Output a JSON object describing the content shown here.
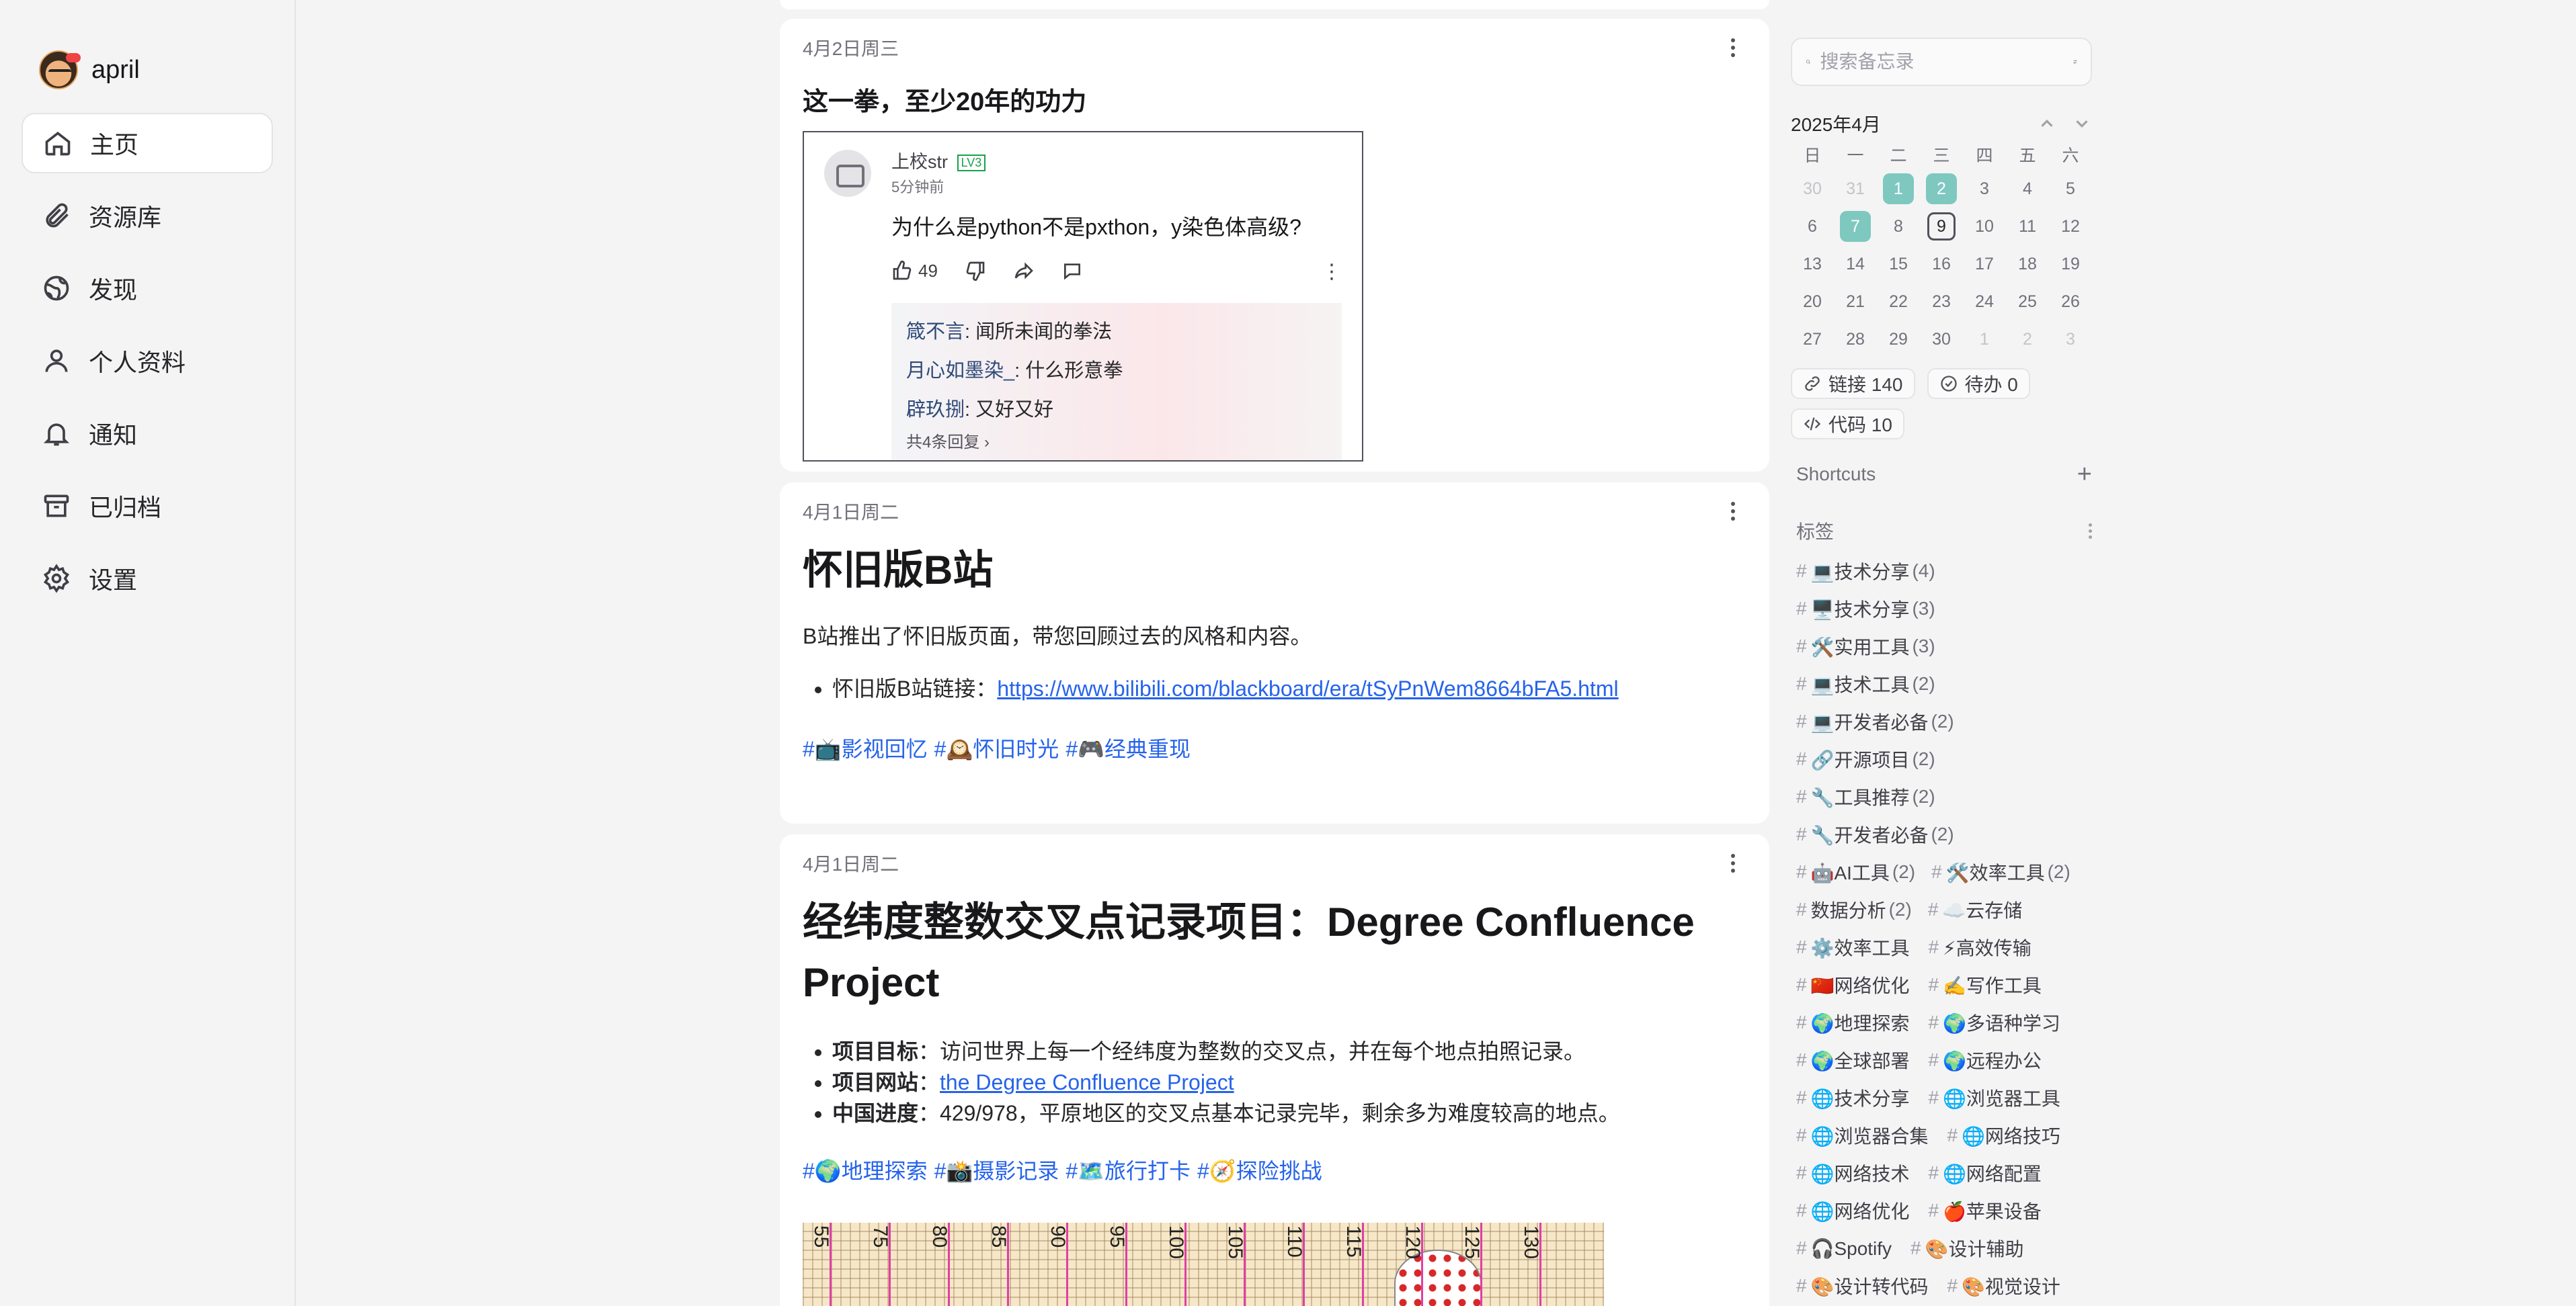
{
  "user": {
    "name": "april"
  },
  "nav": [
    {
      "id": "home",
      "label": "主页",
      "icon": "home-icon",
      "active": true
    },
    {
      "id": "resources",
      "label": "资源库",
      "icon": "paperclip-icon"
    },
    {
      "id": "explore",
      "label": "发现",
      "icon": "globe-icon"
    },
    {
      "id": "profile",
      "label": "个人资料",
      "icon": "user-icon"
    },
    {
      "id": "notifications",
      "label": "通知",
      "icon": "bell-icon"
    },
    {
      "id": "archived",
      "label": "已归档",
      "icon": "archive-icon"
    },
    {
      "id": "settings",
      "label": "设置",
      "icon": "gear-icon"
    }
  ],
  "memos": [
    {
      "date": "4月2日周三",
      "title": "这一拳，至少20年的功力",
      "embed": {
        "user": "上校str",
        "level": "LV3",
        "ago": "5分钟前",
        "question": "为什么是python不是pxthon，y染色体高级?",
        "likes": "49",
        "replies": [
          {
            "who": "箴不言",
            "text": ": 闻所未闻的拳法"
          },
          {
            "who": "月心如墨染_",
            "text": ": 什么形意拳"
          },
          {
            "who": "辟玖捌",
            "text": ": 又好又好"
          }
        ],
        "more_replies": "共4条回复 ›"
      }
    },
    {
      "date": "4月1日周二",
      "title": "怀旧版B站",
      "paragraph": "B站推出了怀旧版页面，带您回顾过去的风格和内容。",
      "bullet_label": "怀旧版B站链接：",
      "bullet_link": "https://www.bilibili.com/blackboard/era/tSyPnWem8664bFA5.html",
      "tags": [
        "#📺影视回忆",
        "#🕰️怀旧时光",
        "#🎮经典重现"
      ]
    },
    {
      "date": "4月1日周二",
      "title_line1": "经纬度整数交叉点记录项目：Degree Confluence",
      "title_line2": "Project",
      "bullets": [
        {
          "label": "项目目标",
          "text": "：访问世界上每一个经纬度为整数的交叉点，并在每个地点拍照记录。"
        },
        {
          "label": "项目网站",
          "text": "：",
          "link": "the Degree Confluence Project"
        },
        {
          "label": "中国进度",
          "text": "：429/978，平原地区的交叉点基本记录完毕，剩余多为难度较高的地点。"
        }
      ],
      "tags": [
        "#🌍地理探索",
        "#📸摄影记录",
        "#🗺️旅行打卡",
        "#🧭探险挑战"
      ],
      "map_labels": [
        "55",
        "75",
        "80",
        "85",
        "90",
        "95",
        "100",
        "105",
        "110",
        "115",
        "120",
        "125",
        "130"
      ]
    }
  ],
  "search": {
    "placeholder": "搜索备忘录"
  },
  "calendar": {
    "title": "2025年4月",
    "weekdays": [
      "日",
      "一",
      "二",
      "三",
      "四",
      "五",
      "六"
    ],
    "days": [
      {
        "d": "30",
        "m": true
      },
      {
        "d": "31",
        "m": true
      },
      {
        "d": "1",
        "hl": true
      },
      {
        "d": "2",
        "hl": true
      },
      {
        "d": "3"
      },
      {
        "d": "4"
      },
      {
        "d": "5"
      },
      {
        "d": "6"
      },
      {
        "d": "7",
        "hl": true
      },
      {
        "d": "8"
      },
      {
        "d": "9",
        "today": true
      },
      {
        "d": "10"
      },
      {
        "d": "11"
      },
      {
        "d": "12"
      },
      {
        "d": "13"
      },
      {
        "d": "14"
      },
      {
        "d": "15"
      },
      {
        "d": "16"
      },
      {
        "d": "17"
      },
      {
        "d": "18"
      },
      {
        "d": "19"
      },
      {
        "d": "20"
      },
      {
        "d": "21"
      },
      {
        "d": "22"
      },
      {
        "d": "23"
      },
      {
        "d": "24"
      },
      {
        "d": "25"
      },
      {
        "d": "26"
      },
      {
        "d": "27"
      },
      {
        "d": "28"
      },
      {
        "d": "29"
      },
      {
        "d": "30"
      },
      {
        "d": "1",
        "m": true
      },
      {
        "d": "2",
        "m": true
      },
      {
        "d": "3",
        "m": true
      }
    ]
  },
  "stats": [
    {
      "label": "链接 140",
      "icon": "link-icon"
    },
    {
      "label": "待办 0",
      "icon": "check-circle-icon"
    },
    {
      "label": "代码 10",
      "icon": "code-icon"
    }
  ],
  "shortcuts": {
    "title": "Shortcuts"
  },
  "tags_section": {
    "title": "标签"
  },
  "tags": [
    {
      "name": "💻技术分享",
      "count": "(4)",
      "full": true
    },
    {
      "name": "🖥️技术分享",
      "count": "(3)",
      "full": true
    },
    {
      "name": "🛠️实用工具",
      "count": "(3)",
      "full": true
    },
    {
      "name": "💻技术工具",
      "count": "(2)",
      "full": true
    },
    {
      "name": "💻开发者必备",
      "count": "(2)",
      "full": true
    },
    {
      "name": "🔗开源项目",
      "count": "(2)",
      "full": true
    },
    {
      "name": "🔧工具推荐",
      "count": "(2)",
      "full": true
    },
    {
      "name": "🔧开发者必备",
      "count": "(2)",
      "full": true
    },
    {
      "name": "🤖AI工具",
      "count": "(2)"
    },
    {
      "name": "🛠️效率工具",
      "count": "(2)"
    },
    {
      "name": "数据分析",
      "count": "(2)"
    },
    {
      "name": "☁️云存储",
      "count": ""
    },
    {
      "name": "⚙️效率工具",
      "count": ""
    },
    {
      "name": "⚡高效传输",
      "count": ""
    },
    {
      "name": "🇨🇳网络优化",
      "count": ""
    },
    {
      "name": "✍️写作工具",
      "count": ""
    },
    {
      "name": "🌍地理探索",
      "count": ""
    },
    {
      "name": "🌍多语种学习",
      "count": ""
    },
    {
      "name": "🌍全球部署",
      "count": ""
    },
    {
      "name": "🌍远程办公",
      "count": ""
    },
    {
      "name": "🌐技术分享",
      "count": ""
    },
    {
      "name": "🌐浏览器工具",
      "count": ""
    },
    {
      "name": "🌐浏览器合集",
      "count": ""
    },
    {
      "name": "🌐网络技巧",
      "count": ""
    },
    {
      "name": "🌐网络技术",
      "count": ""
    },
    {
      "name": "🌐网络配置",
      "count": ""
    },
    {
      "name": "🌐网络优化",
      "count": ""
    },
    {
      "name": "🍎苹果设备",
      "count": ""
    },
    {
      "name": "🎧Spotify",
      "count": ""
    },
    {
      "name": "🎨设计辅助",
      "count": ""
    },
    {
      "name": "🎨设计转代码",
      "count": ""
    },
    {
      "name": "🎨视觉设计",
      "count": ""
    }
  ],
  "colors": {
    "accent": "#2563eb",
    "calendar_highlight": "#7ec8c0",
    "background": "#f4f4f5"
  }
}
